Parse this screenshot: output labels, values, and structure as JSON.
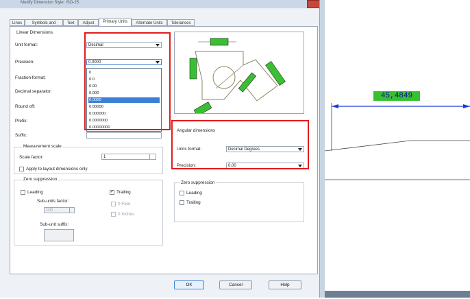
{
  "window": {
    "title": "Modify Dimension Style: ISO-25"
  },
  "tabs": [
    {
      "label": "Lines"
    },
    {
      "label": "Symbols and Arrows"
    },
    {
      "label": "Text"
    },
    {
      "label": "Adjust"
    },
    {
      "label": "Primary Units"
    },
    {
      "label": "Alternate Units"
    },
    {
      "label": "Tolerances"
    }
  ],
  "linear": {
    "section_title": "Linear Dimensions",
    "unit_format_label": "Unit format:",
    "unit_format_value": "Decimal",
    "precision_label": "Precision:",
    "precision_value": "0.0000",
    "precision_options": [
      "0",
      "0.0",
      "0.00",
      "0.000",
      "0.0000",
      "0.00000",
      "0.000000",
      "0.0000000",
      "0.00000000"
    ],
    "precision_selected_index": 4,
    "fraction_format_label": "Fraction format:",
    "decimal_separator_label": "Decimal separator:",
    "round_off_label": "Round off:",
    "prefix_label": "Prefix:",
    "suffix_label": "Suffix:"
  },
  "measurement_scale": {
    "title": "Measurement scale",
    "scale_factor_label": "Scale factor:",
    "scale_factor_value": "1",
    "apply_layout_label": "Apply to layout dimensions only"
  },
  "zero_suppression": {
    "title": "Zero suppression",
    "leading_label": "Leading",
    "trailing_label": "Trailing",
    "sub_units_factor_label": "Sub-units factor:",
    "sub_units_factor_value": "100",
    "feet_label": "0 Feet",
    "inches_label": "0 Inches",
    "sub_unit_suffix_label": "Sub-unit suffix:"
  },
  "angular": {
    "title": "Angular dimensions",
    "units_format_label": "Units format:",
    "units_format_value": "Decimal Degrees",
    "precision_label": "Precision:",
    "precision_value": "0.00",
    "zero_title": "Zero suppression",
    "leading_label": "Leading",
    "trailing_label": "Trailing"
  },
  "buttons": {
    "ok": "OK",
    "cancel": "Cancel",
    "help": "Help"
  },
  "drawing": {
    "dimension_value": "45,4849"
  },
  "colors": {
    "highlight_box": "#e21b1b",
    "dimension_fill": "#39c032",
    "selection": "#3b7fd8"
  }
}
